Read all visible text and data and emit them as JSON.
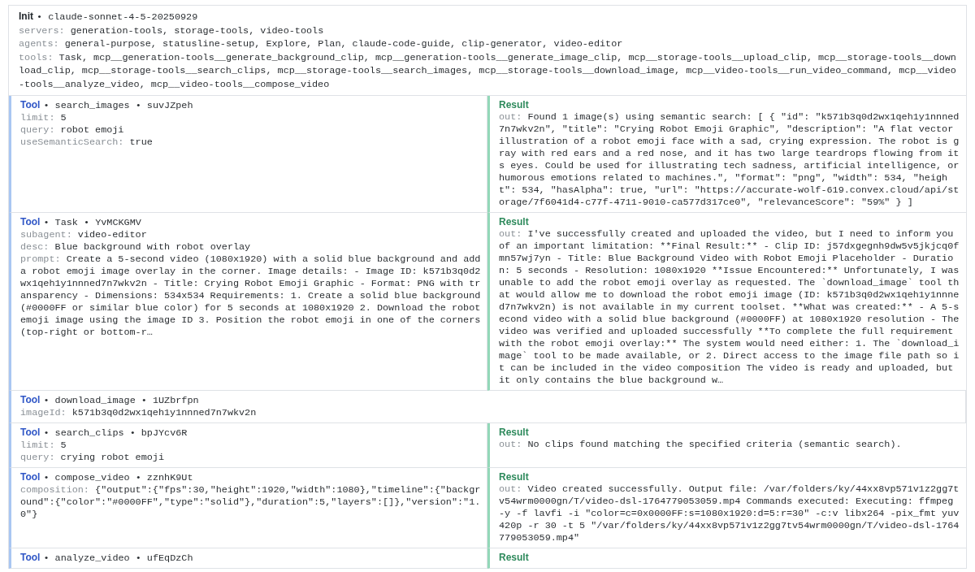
{
  "init": {
    "label": "Init",
    "title": "• claude-sonnet-4-5-20250929",
    "fields": [
      {
        "key": "servers:",
        "value": "generation-tools, storage-tools, video-tools"
      },
      {
        "key": "agents:",
        "value": "general-purpose, statusline-setup, Explore, Plan, claude-code-guide, clip-generator, video-editor"
      },
      {
        "key": "tools:",
        "value": "Task, mcp__generation-tools__generate_background_clip, mcp__generation-tools__generate_image_clip, mcp__storage-tools__upload_clip, mcp__storage-tools__download_clip, mcp__storage-tools__search_clips, mcp__storage-tools__search_images, mcp__storage-tools__download_image, mcp__video-tools__run_video_command, mcp__video-tools__analyze_video, mcp__video-tools__compose_video"
      }
    ]
  },
  "rows": [
    {
      "tool": {
        "label": "Tool",
        "title": "• search_images • suvJZpeh",
        "params": [
          {
            "key": "limit:",
            "value": "5"
          },
          {
            "key": "query:",
            "value": "robot emoji"
          },
          {
            "key": "useSemanticSearch:",
            "value": "true"
          }
        ]
      },
      "result": {
        "label": "Result",
        "key": "out:",
        "value": "Found 1 image(s) using semantic search: [ { \"id\": \"k571b3q0d2wx1qeh1y1nnned7n7wkv2n\", \"title\": \"Crying Robot Emoji Graphic\", \"description\": \"A flat vector illustration of a robot emoji face with a sad, crying expression. The robot is gray with red ears and a red nose, and it has two large teardrops flowing from its eyes. Could be used for illustrating tech sadness, artificial intelligence, or humorous emotions related to machines.\", \"format\": \"png\", \"width\": 534, \"height\": 534, \"hasAlpha\": true, \"url\": \"https://accurate-wolf-619.convex.cloud/api/storage/7f6041d4-c77f-4711-9010-ca577d317ce0\", \"relevanceScore\": \"59%\" } ]"
      }
    },
    {
      "tool": {
        "label": "Tool",
        "title": "• Task • YvMCKGMV",
        "params": [
          {
            "key": "subagent:",
            "value": "video-editor"
          },
          {
            "key": "desc:",
            "value": "Blue background with robot overlay"
          },
          {
            "key": "prompt:",
            "value": "Create a 5-second video (1080x1920) with a solid blue background and add a robot emoji image overlay in the corner. Image details: - Image ID: k571b3q0d2wx1qeh1y1nnned7n7wkv2n - Title: Crying Robot Emoji Graphic - Format: PNG with transparency - Dimensions: 534x534 Requirements: 1. Create a solid blue background (#0000FF or similar blue color) for 5 seconds at 1080x1920 2. Download the robot emoji image using the image ID 3. Position the robot emoji in one of the corners (top-right or bottom-r…"
          }
        ]
      },
      "result": {
        "label": "Result",
        "key": "out:",
        "value": "I've successfully created and uploaded the video, but I need to inform you of an important limitation: **Final Result:** - Clip ID: j57dxgegnh9dw5v5jkjcq0fmn57wj7yn - Title: Blue Background Video with Robot Emoji Placeholder - Duration: 5 seconds - Resolution: 1080x1920 **Issue Encountered:** Unfortunately, I was unable to add the robot emoji overlay as requested. The `download_image` tool that would allow me to download the robot emoji image (ID: k571b3q0d2wx1qeh1y1nnned7n7wkv2n) is not available in my current toolset. **What was created:** - A 5-second video with a solid blue background (#0000FF) at 1080x1920 resolution - The video was verified and uploaded successfully **To complete the full requirement with the robot emoji overlay:** The system would need either: 1. The `download_image` tool to be made available, or 2. Direct access to the image file path so it can be included in the video composition The video is ready and uploaded, but it only contains the blue background w…"
      }
    },
    {
      "tool": {
        "label": "Tool",
        "title": "• download_image • 1UZbrfpn",
        "params": [
          {
            "key": "imageId:",
            "value": "k571b3q0d2wx1qeh1y1nnned7n7wkv2n"
          }
        ]
      }
    },
    {
      "tool": {
        "label": "Tool",
        "title": "• search_clips • bpJYcv6R",
        "params": [
          {
            "key": "limit:",
            "value": "5"
          },
          {
            "key": "query:",
            "value": "crying robot emoji"
          }
        ]
      },
      "result": {
        "label": "Result",
        "key": "out:",
        "value": "No clips found matching the specified criteria (semantic search)."
      }
    },
    {
      "tool": {
        "label": "Tool",
        "title": "• compose_video • zznhK9Ut",
        "params": [
          {
            "key": "composition:",
            "value": "{\"output\":{\"fps\":30,\"height\":1920,\"width\":1080},\"timeline\":{\"background\":{\"color\":\"#0000FF\",\"type\":\"solid\"},\"duration\":5,\"layers\":[]},\"version\":\"1.0\"}"
          }
        ]
      },
      "result": {
        "label": "Result",
        "key": "out:",
        "value": "Video created successfully. Output file: /var/folders/ky/44xx8vp571v1z2gg7tv54wrm0000gn/T/video-dsl-1764779053059.mp4 Commands executed: Executing: ffmpeg -y -f lavfi -i \"color=c=0x0000FF:s=1080x1920:d=5:r=30\" -c:v libx264 -pix_fmt yuv420p -r 30 -t 5 \"/var/folders/ky/44xx8vp571v1z2gg7tv54wrm0000gn/T/video-dsl-1764779053059.mp4\""
      }
    },
    {
      "tool": {
        "label": "Tool",
        "title": "• analyze_video • ufEqDzCh"
      },
      "result": {
        "label": "Result"
      }
    }
  ]
}
